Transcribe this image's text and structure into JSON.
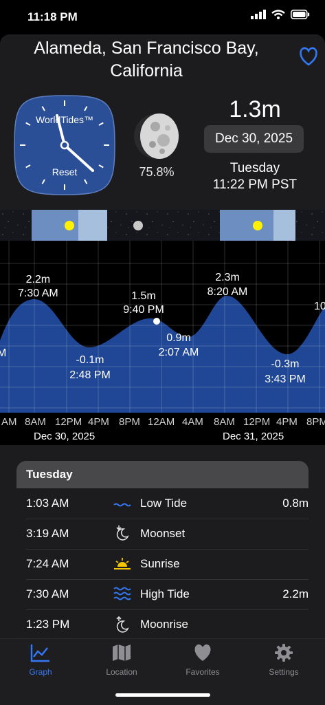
{
  "status": {
    "time": "11:18 PM"
  },
  "header": {
    "location": "Alameda, San Francisco Bay, California"
  },
  "clock": {
    "brand": "WorldTides™",
    "reset": "Reset"
  },
  "moon": {
    "illumination": "75.8%"
  },
  "current": {
    "height": "1.3m",
    "date": "Dec 30, 2025",
    "weekday": "Tuesday",
    "time": "11:22 PM PST"
  },
  "graph": {
    "labels": [
      {
        "height": "2.2m",
        "time": "7:30 AM"
      },
      {
        "height": "-0.1m",
        "time": "2:48 PM"
      },
      {
        "height": "1.5m",
        "time": "9:40 PM"
      },
      {
        "height": "0.9m",
        "time": "2:07 AM"
      },
      {
        "height": "2.3m",
        "time": "8:20 AM"
      },
      {
        "height": "-0.3m",
        "time": "3:43 PM"
      },
      {
        "height": "10",
        "time": ""
      },
      {
        "height": "M",
        "time": ""
      }
    ],
    "ticks": [
      "AM",
      "8AM",
      "12PM",
      "4PM",
      "8PM",
      "12AM",
      "4AM",
      "8AM",
      "12PM",
      "4PM",
      "8PM"
    ],
    "days": [
      "Dec 30, 2025",
      "Dec 31, 2025"
    ]
  },
  "panel": {
    "title": "Tuesday",
    "rows": [
      {
        "time": "1:03 AM",
        "event": "Low Tide",
        "height": "0.8m",
        "icon": "low-tide-icon"
      },
      {
        "time": "3:19 AM",
        "event": "Moonset",
        "height": "",
        "icon": "moonset-icon"
      },
      {
        "time": "7:24 AM",
        "event": "Sunrise",
        "height": "",
        "icon": "sunrise-icon"
      },
      {
        "time": "7:30 AM",
        "event": "High Tide",
        "height": "2.2m",
        "icon": "high-tide-icon"
      },
      {
        "time": "1:23 PM",
        "event": "Moonrise",
        "height": "",
        "icon": "moonrise-icon"
      }
    ]
  },
  "tabs": [
    {
      "label": "Graph",
      "icon": "graph-icon",
      "active": true
    },
    {
      "label": "Location",
      "icon": "map-icon",
      "active": false
    },
    {
      "label": "Favorites",
      "icon": "heart-icon",
      "active": false
    },
    {
      "label": "Settings",
      "icon": "gear-icon",
      "active": false
    }
  ],
  "colors": {
    "accent": "#3478f6",
    "tide_fill": "#1f4795",
    "clock_face": "#2b4f96",
    "sun": "#fff200"
  }
}
